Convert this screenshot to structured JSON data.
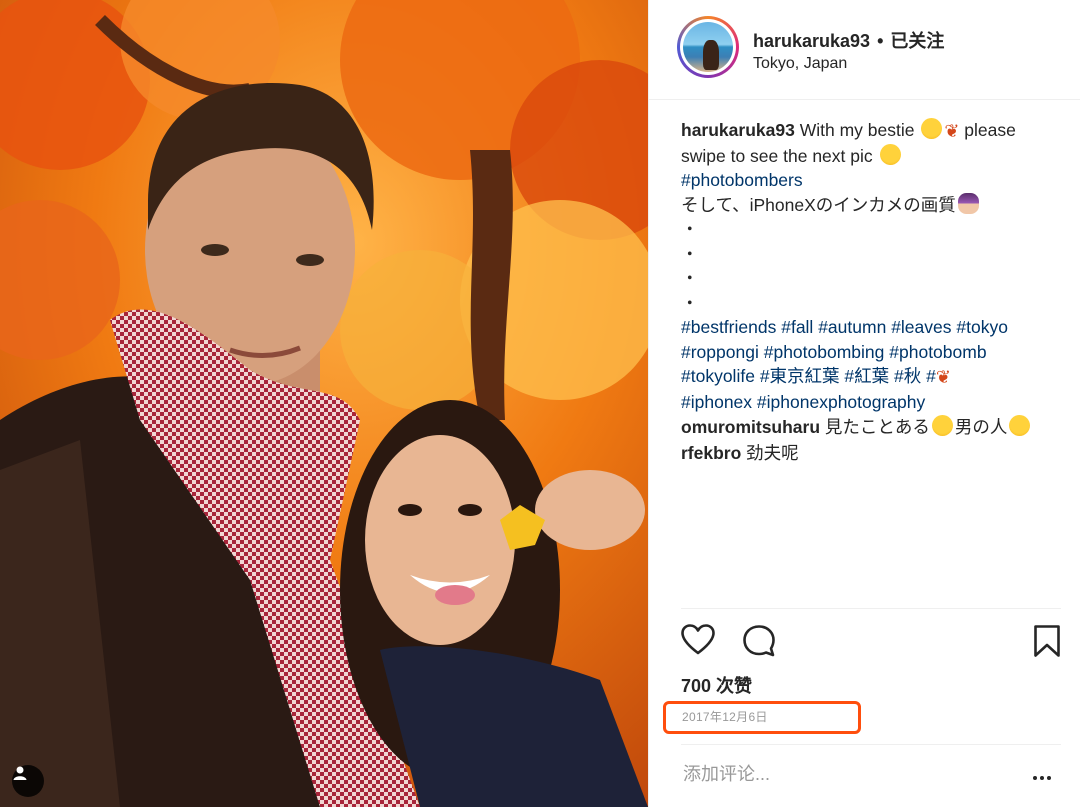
{
  "post": {
    "username": "harukaruka93",
    "separator": "•",
    "follow_status": "已关注",
    "location": "Tokyo, Japan"
  },
  "caption": {
    "username": "harukaruka93",
    "line1_text": "With my bestie",
    "line1_tail": "please",
    "line2_text": "swipe to see the next pic",
    "line3_tag": "#photobombers",
    "line4_text": "そして、iPhoneXのインカメの画質",
    "dots": [
      "・",
      "・",
      "・",
      "・"
    ],
    "tags_line1": [
      "#bestfriends",
      "#fall",
      "#autumn",
      "#leaves",
      "#tokyo"
    ],
    "tags_line2": [
      "#roppongi",
      "#photobombing",
      "#photobomb"
    ],
    "tags_line3": [
      "#tokyolife",
      "#東京紅葉",
      "#紅葉",
      "#秋",
      "#"
    ],
    "tags_line4": [
      "#iphonex",
      "#iphonexphotography"
    ]
  },
  "comments": [
    {
      "username": "omuromitsuharu",
      "text_a": "見たことある",
      "text_b": "男の人"
    },
    {
      "username": "rfekbro",
      "text_a": "劲夫呢",
      "text_b": ""
    }
  ],
  "actions": {
    "like_icon": "heart-icon",
    "comment_icon": "comment-bubble-icon",
    "save_icon": "bookmark-icon"
  },
  "likes": "700 次赞",
  "date": "2017年12月6日",
  "comment_placeholder": "添加评论...",
  "more_icon": "ellipsis-icon",
  "colors": {
    "hashtag": "#003569",
    "highlight_box": "#ff4e0d",
    "muted": "#999999"
  }
}
